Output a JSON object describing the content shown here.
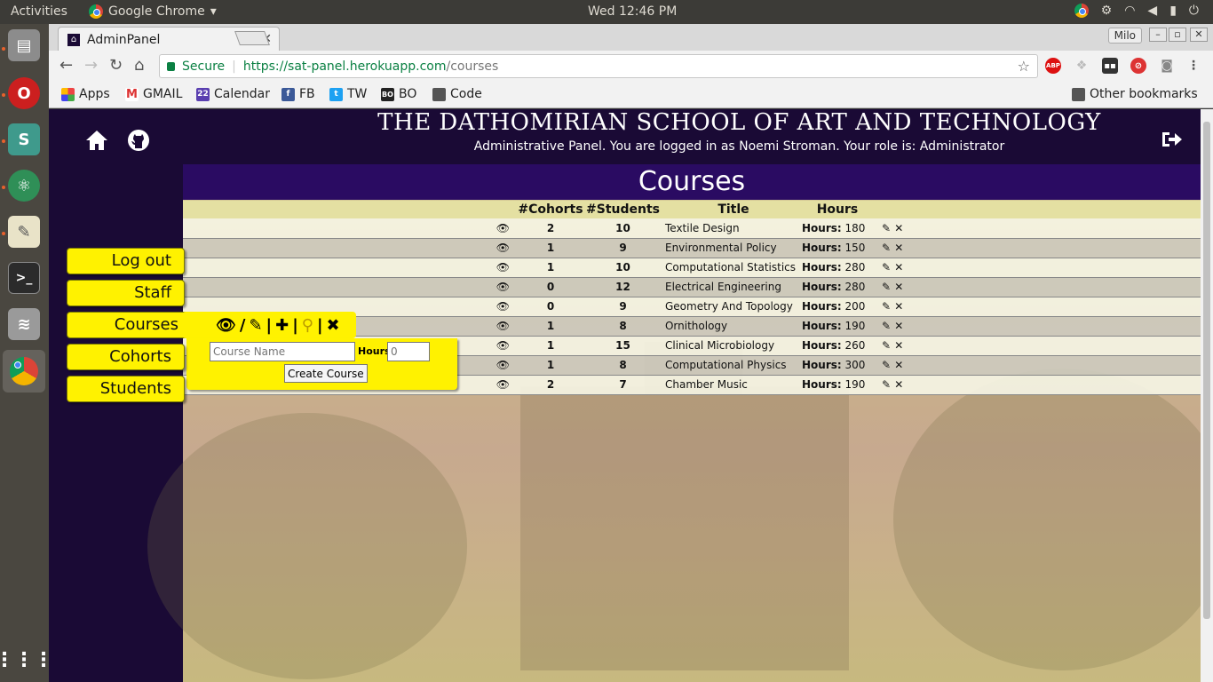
{
  "os": {
    "activities": "Activities",
    "app_name": "Google Chrome",
    "clock": "Wed 12:46 PM"
  },
  "browser": {
    "tab_title": "AdminPanel",
    "profile": "Milo",
    "secure_label": "Secure",
    "url_scheme_host": "https://sat-panel.herokuapp.com",
    "url_path": "/courses",
    "bookmarks": [
      {
        "label": "Apps",
        "icon": "apps-grid-icon"
      },
      {
        "label": "GMAIL",
        "icon": "gmail-icon"
      },
      {
        "label": "Calendar",
        "icon": "calendar-icon"
      },
      {
        "label": "FB",
        "icon": "facebook-icon"
      },
      {
        "label": "TW",
        "icon": "twitter-icon"
      },
      {
        "label": "BO",
        "icon": "bo-icon"
      },
      {
        "label": "Code",
        "icon": "folder-icon"
      }
    ],
    "other_bookmarks": "Other bookmarks"
  },
  "header": {
    "title": "THE DATHOMIRIAN SCHOOL OF ART AND TECHNOLOGY",
    "subtitle": "Administrative Panel. You are logged in as Noemi Stroman. Your role is: Administrator"
  },
  "menu": {
    "logout": "Log out",
    "staff": "Staff",
    "courses": "Courses",
    "cohorts": "Cohorts",
    "students": "Students"
  },
  "course_form": {
    "name_placeholder": "Course Name",
    "hours_label": "Hours:",
    "hours_placeholder": "0",
    "create_label": "Create Course"
  },
  "courses": {
    "title": "Courses",
    "columns": [
      "#Cohorts",
      "#Students",
      "Title",
      "Hours"
    ],
    "hours_prefix": "Hours:",
    "rows": [
      {
        "cohorts": "2",
        "students": "10",
        "title": "Textile Design",
        "hours": "180"
      },
      {
        "cohorts": "1",
        "students": "9",
        "title": "Environmental Policy",
        "hours": "150"
      },
      {
        "cohorts": "1",
        "students": "10",
        "title": "Computational Statistics",
        "hours": "280"
      },
      {
        "cohorts": "0",
        "students": "12",
        "title": "Electrical Engineering",
        "hours": "280"
      },
      {
        "cohorts": "0",
        "students": "9",
        "title": "Geometry And Topology",
        "hours": "200"
      },
      {
        "cohorts": "1",
        "students": "8",
        "title": "Ornithology",
        "hours": "190"
      },
      {
        "cohorts": "1",
        "students": "15",
        "title": "Clinical Microbiology",
        "hours": "260"
      },
      {
        "cohorts": "1",
        "students": "8",
        "title": "Computational Physics",
        "hours": "300"
      },
      {
        "cohorts": "2",
        "students": "7",
        "title": "Chamber Music",
        "hours": "190"
      }
    ]
  }
}
